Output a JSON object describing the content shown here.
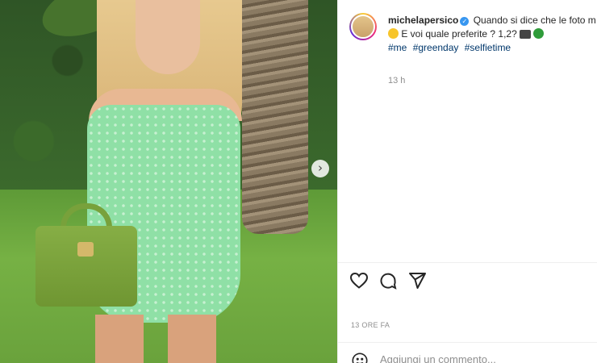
{
  "post": {
    "username": "michelapersico",
    "caption_line1": "Quando si dice che le foto m",
    "caption_line2": "E voi quale preferite ? 1,2?",
    "hashtags": [
      "#me",
      "#greenday",
      "#selfietime"
    ],
    "caption_time": "13 h",
    "timestamp": "13 ORE FA",
    "verified_glyph": "✓",
    "next_glyph": "›"
  },
  "comment": {
    "placeholder": "Aggiungi un commento..."
  },
  "icons": {
    "like": "heart-icon",
    "comment": "comment-icon",
    "share": "share-icon",
    "emoji": "smiley-icon",
    "next": "chevron-right-icon"
  },
  "colors": {
    "accent_link": "#00376b",
    "verified": "#3897f0",
    "muted": "#8e8e8e",
    "dress_green": "#8fe0a6"
  }
}
